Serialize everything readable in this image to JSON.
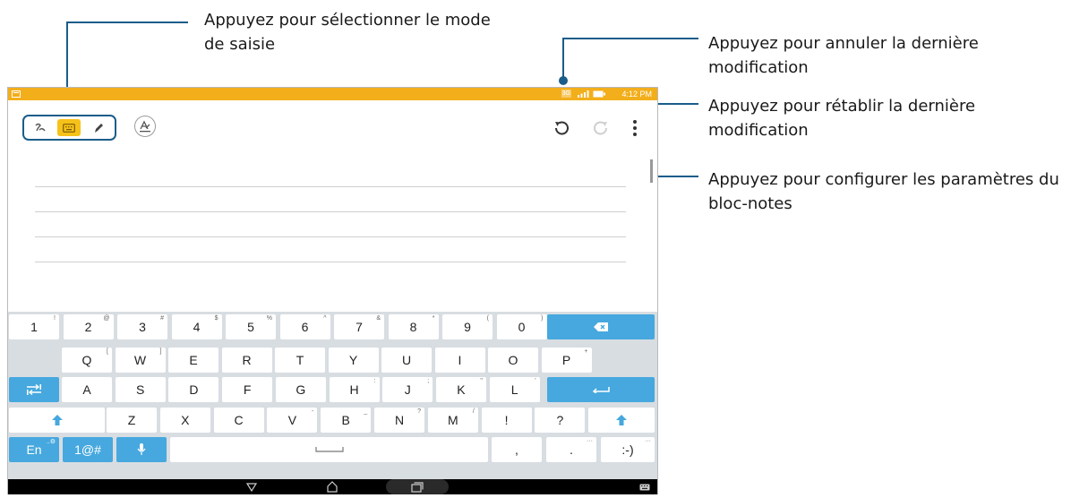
{
  "annotations": {
    "input_mode": "Appuyez pour sélectionner le mode de saisie",
    "undo": "Appuyez pour annuler la dernière modification",
    "redo": "Appuyez pour rétablir la dernière modification",
    "settings": "Appuyez pour configurer les paramètres du bloc-notes"
  },
  "status_bar": {
    "time": "4:12 PM",
    "network": "3G"
  },
  "toolbar": {
    "modes": [
      "handwriting-icon",
      "keyboard-icon",
      "pen-icon"
    ],
    "selected_mode": "keyboard"
  },
  "keyboard": {
    "row1": [
      {
        "k": "1",
        "h": "!"
      },
      {
        "k": "2",
        "h": "@"
      },
      {
        "k": "3",
        "h": "#"
      },
      {
        "k": "4",
        "h": "$"
      },
      {
        "k": "5",
        "h": "%"
      },
      {
        "k": "6",
        "h": "^"
      },
      {
        "k": "7",
        "h": "&"
      },
      {
        "k": "8",
        "h": "*"
      },
      {
        "k": "9",
        "h": "("
      },
      {
        "k": "0",
        "h": ")"
      }
    ],
    "row2": [
      {
        "k": "Q",
        "h": "["
      },
      {
        "k": "W",
        "h": "]"
      },
      {
        "k": "E",
        "h": ""
      },
      {
        "k": "R",
        "h": ""
      },
      {
        "k": "T",
        "h": ""
      },
      {
        "k": "Y",
        "h": ""
      },
      {
        "k": "U",
        "h": ""
      },
      {
        "k": "I",
        "h": ""
      },
      {
        "k": "O",
        "h": ""
      },
      {
        "k": "P",
        "h": "+"
      }
    ],
    "row3": [
      {
        "k": "A",
        "h": ""
      },
      {
        "k": "S",
        "h": ""
      },
      {
        "k": "D",
        "h": ""
      },
      {
        "k": "F",
        "h": ""
      },
      {
        "k": "G",
        "h": ""
      },
      {
        "k": "H",
        "h": ":"
      },
      {
        "k": "J",
        "h": ";"
      },
      {
        "k": "K",
        "h": "\""
      },
      {
        "k": "L",
        "h": "'"
      }
    ],
    "row4": [
      {
        "k": "Z",
        "h": ""
      },
      {
        "k": "X",
        "h": ""
      },
      {
        "k": "C",
        "h": ""
      },
      {
        "k": "V",
        "h": "-"
      },
      {
        "k": "B",
        "h": "_"
      },
      {
        "k": "N",
        "h": "?"
      },
      {
        "k": "M",
        "h": "/"
      },
      {
        "k": "!",
        "h": ""
      },
      {
        "k": "?",
        "h": ""
      }
    ],
    "lang_label": "En",
    "lang_hint": "..⚙",
    "symbols_label": "1@#",
    "comma_label": ",",
    "period_label": ".",
    "period_hint": "···",
    "emoji_label": ":-)",
    "emoji_hint": "···",
    "accent_color": "#46a8de"
  }
}
